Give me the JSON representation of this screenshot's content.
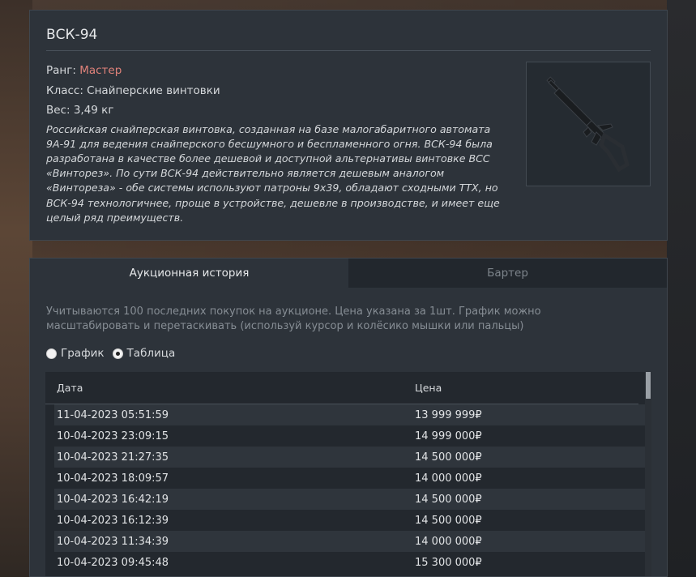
{
  "item": {
    "title": "ВСК-94",
    "rank_label": "Ранг: ",
    "rank_value": "Мастер",
    "class_text": "Класс: Снайперские винтовки",
    "weight_text": "Вес: 3,49 кг",
    "description": "Российская снайперская винтовка, созданная на базе малогабаритного автомата 9А-91 для ведения снайперского бесшумного и беспламенного огня. ВСК-94 была разработана в качестве более дешевой и доступной альтернативы винтовке ВСС «Винторез». По сути ВСК-94 действительно является дешевым аналогом «Винтореза» - обе системы используют патроны 9x39, обладают сходными ТТХ, но ВСК-94 технологичнее, проще в устройстве, дешевле в производстве, и имеет еще целый ряд преимуществ."
  },
  "tabs": [
    "Аукционная история",
    "Бартер"
  ],
  "hint": "Учитываются 100 последних покупок на аукционе. Цена указана за 1шт. График можно масштабировать и перетаскивать (используй курсор и колёсико мышки или пальцы)",
  "view_options": [
    "График",
    "Таблица"
  ],
  "table": {
    "headers": [
      "Дата",
      "Цена"
    ],
    "rows": [
      [
        "11-04-2023 05:51:59",
        "13 999 999₽"
      ],
      [
        "10-04-2023 23:09:15",
        "14 999 000₽"
      ],
      [
        "10-04-2023 21:27:35",
        "14 500 000₽"
      ],
      [
        "10-04-2023 18:09:57",
        "14 000 000₽"
      ],
      [
        "10-04-2023 16:42:19",
        "14 500 000₽"
      ],
      [
        "10-04-2023 16:12:39",
        "14 500 000₽"
      ],
      [
        "10-04-2023 11:34:39",
        "14 000 000₽"
      ],
      [
        "10-04-2023 09:45:48",
        "15 300 000₽"
      ]
    ]
  }
}
